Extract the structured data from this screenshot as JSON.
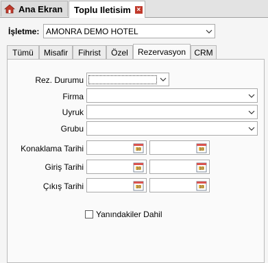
{
  "doc_tabs": [
    {
      "label": "Ana Ekran"
    },
    {
      "label": "Toplu Iletisim",
      "close": "×"
    }
  ],
  "isletme": {
    "label": "İşletme:",
    "value": "AMONRA DEMO HOTEL"
  },
  "tabs": [
    {
      "label": "Tümü"
    },
    {
      "label": "Misafir"
    },
    {
      "label": "Fihrist"
    },
    {
      "label": "Özel"
    },
    {
      "label": "Rezervasyon",
      "active": true
    },
    {
      "label": "CRM"
    }
  ],
  "form": {
    "rez_durumu": {
      "label": "Rez. Durumu",
      "value": ""
    },
    "firma": {
      "label": "Firma",
      "value": ""
    },
    "uyruk": {
      "label": "Uyruk",
      "value": ""
    },
    "grubu": {
      "label": "Grubu",
      "value": ""
    },
    "konaklama": {
      "label": "Konaklama Tarihi",
      "from": "",
      "to": ""
    },
    "giris": {
      "label": "Giriş Tarihi",
      "from": "",
      "to": ""
    },
    "cikis": {
      "label": "Çıkış Tarihi",
      "from": "",
      "to": ""
    },
    "yanindakiler": {
      "label": "Yanındakiler Dahil",
      "checked": false
    }
  },
  "icons": {
    "home": "home-icon",
    "calendar": "calendar-icon",
    "dropdown": "chevron-down-icon"
  },
  "colors": {
    "close_button": "#c0392b",
    "home_icon": "#c0392b"
  }
}
